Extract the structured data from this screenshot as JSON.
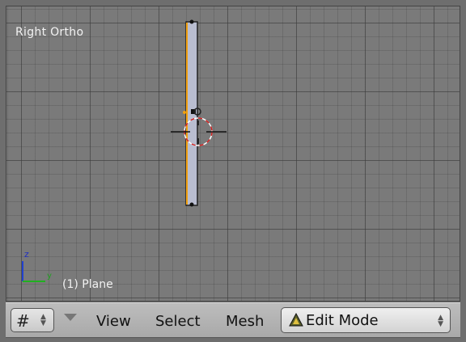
{
  "viewport": {
    "view_label": "Right Ortho",
    "object_label": "(1) Plane",
    "axis_z": "z",
    "axis_y": "y"
  },
  "header": {
    "grid_button_icon": "grid-icon",
    "menus": [
      "View",
      "Select",
      "Mesh"
    ],
    "mode": "Edit Mode",
    "mode_icon": "edit-mode-icon"
  },
  "colors": {
    "viewport_bg": "#7a7a7a",
    "header_bg": "#b3b3b3",
    "selected_edge": "#f0a010",
    "cursor_ring_red": "#d02020",
    "axis_z": "#2040d0",
    "axis_y": "#20b020"
  }
}
